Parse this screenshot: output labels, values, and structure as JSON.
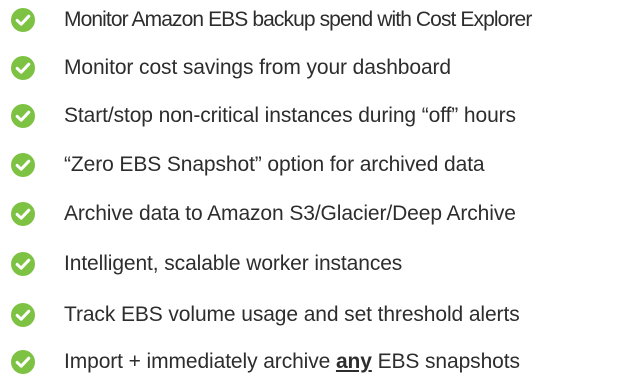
{
  "features": [
    {
      "text": "Monitor Amazon EBS backup spend with Cost Explorer"
    },
    {
      "text": "Monitor cost savings from your dashboard"
    },
    {
      "text": "Start/stop non-critical instances during “off” hours"
    },
    {
      "text": "“Zero EBS Snapshot” option for archived data"
    },
    {
      "text": "Archive data to Amazon S3/Glacier/Deep Archive"
    },
    {
      "text": "Intelligent, scalable worker instances"
    },
    {
      "text": "Track EBS volume usage and set threshold alerts"
    },
    {
      "before": "Import + immediately archive ",
      "emphasis": "any",
      "after": " EBS snapshots"
    }
  ],
  "icon": {
    "name": "check-circle-icon",
    "color": "#7dc242",
    "check_color": "#ffffff"
  }
}
